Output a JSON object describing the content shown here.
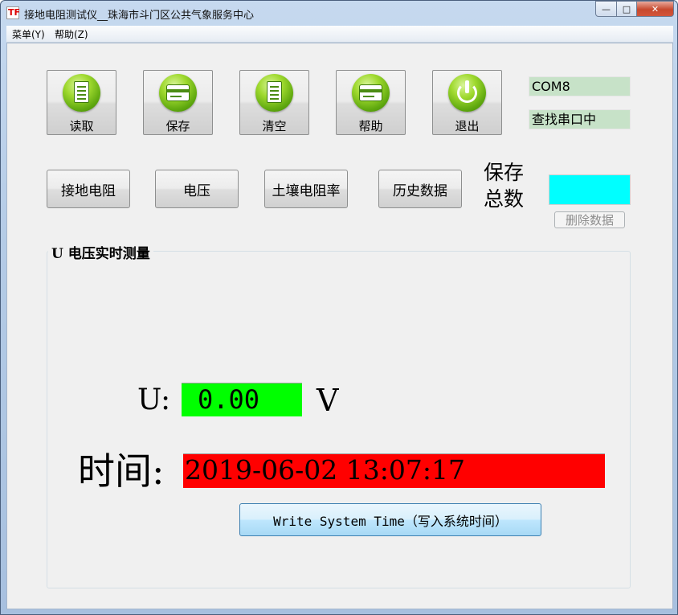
{
  "window": {
    "title": "接地电阻测试仪__珠海市斗门区公共气象服务中心",
    "icon_text": "TF"
  },
  "menu": {
    "items": [
      {
        "label": "菜单(Y)"
      },
      {
        "label": "帮助(Z)"
      }
    ]
  },
  "toolbar": {
    "read_label": "读取",
    "save_label": "保存",
    "clear_label": "清空",
    "help_label": "帮助",
    "exit_label": "退出"
  },
  "status": {
    "port": "COM8",
    "port_state": "查找串口中"
  },
  "modes": {
    "ground_resistance": "接地电阻",
    "voltage": "电压",
    "soil_resistivity": "土壤电阻率",
    "history": "历史数据"
  },
  "save_total": {
    "label": "保存总数",
    "value": "",
    "delete_label": "删除数据"
  },
  "measurement": {
    "group_title": "U 电压实时测量",
    "u_label": "U:",
    "u_value": "0.00",
    "u_unit": "V",
    "time_label": "时间:",
    "time_value": "2019-06-02 13:07:17",
    "write_button": "Write System Time（写入系统时间）"
  },
  "colors": {
    "voltage_bg": "#00ff00",
    "time_bg": "#ff0000",
    "save_total_bg": "#00ffff",
    "status_bg": "#c7e2c8"
  }
}
